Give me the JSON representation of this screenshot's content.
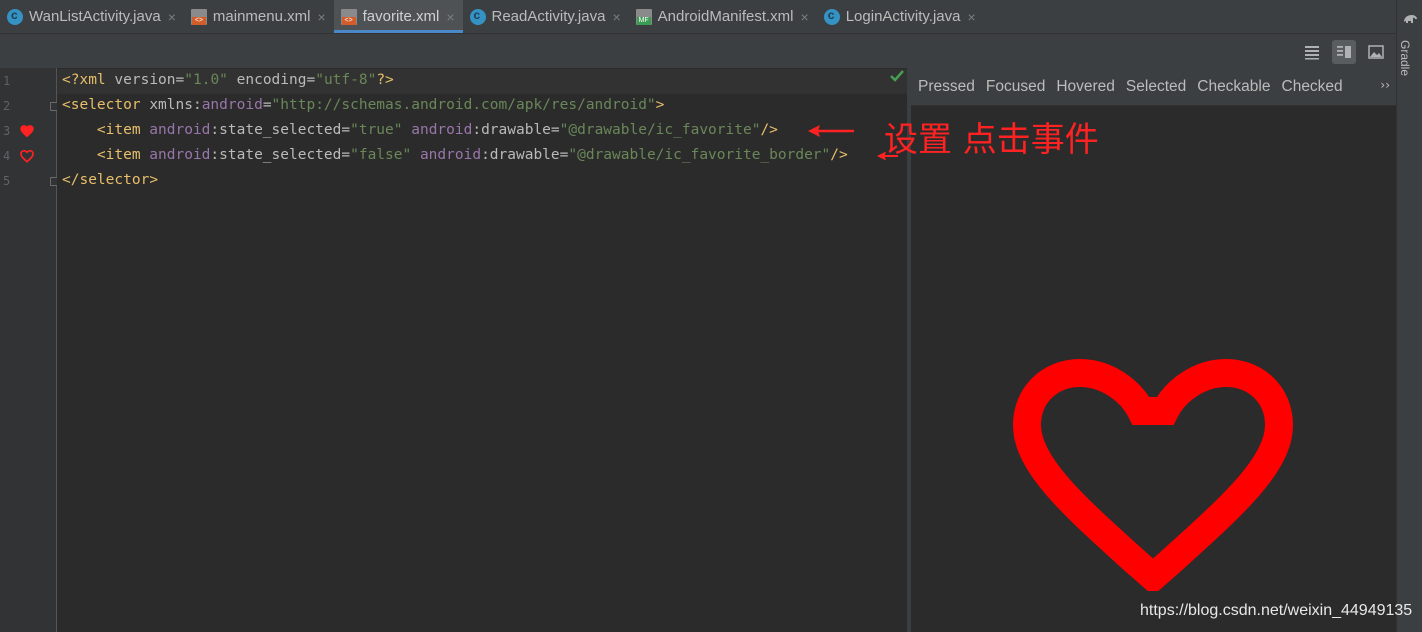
{
  "tabs": [
    {
      "label": "WanListActivity.java",
      "icon": "java-class-icon"
    },
    {
      "label": "mainmenu.xml",
      "icon": "xml-file-icon"
    },
    {
      "label": "favorite.xml",
      "icon": "xml-file-icon",
      "active": true
    },
    {
      "label": "ReadActivity.java",
      "icon": "java-class-icon"
    },
    {
      "label": "AndroidManifest.xml",
      "icon": "manifest-file-icon"
    },
    {
      "label": "LoginActivity.java",
      "icon": "java-class-icon"
    }
  ],
  "tab_close_glyph": "×",
  "toolbar": {
    "icons": [
      "code-view-icon",
      "split-view-icon",
      "design-view-icon"
    ],
    "active": "split-view-icon"
  },
  "gutter": {
    "line_numbers": [
      "1",
      "2",
      "3",
      "4",
      "5"
    ],
    "heart_color": "#ff2222"
  },
  "code": {
    "line1": {
      "open": "<?",
      "tag": "xml",
      "attr1": " version",
      "eq1": "=",
      "val1": "\"1.0\"",
      "attr2": " encoding",
      "eq2": "=",
      "val2": "\"utf-8\"",
      "close": "?>"
    },
    "line2": {
      "open": "<",
      "tag": "selector",
      "space": " ",
      "ns": "xmlns:",
      "nsname": "android",
      "eq": "=",
      "val": "\"http://schemas.android.com/apk/res/android\"",
      "close": ">"
    },
    "line3": {
      "indent": "    ",
      "open": "<",
      "tag": "item",
      "ns1": " android",
      "attr1": ":state_selected",
      "eq1": "=",
      "val1": "\"true\"",
      "ns2": " android",
      "attr2": ":drawable",
      "eq2": "=",
      "val2": "\"@drawable/ic_favorite\"",
      "close": "/>"
    },
    "line4": {
      "indent": "    ",
      "open": "<",
      "tag": "item",
      "ns1": " android",
      "attr1": ":state_selected",
      "eq1": "=",
      "val1": "\"false\"",
      "ns2": " android",
      "attr2": ":drawable",
      "eq2": "=",
      "val2": "\"@drawable/ic_favorite_border\"",
      "close": "/>"
    },
    "line5": {
      "open": "</",
      "tag": "selector",
      "close": ">"
    }
  },
  "preview": {
    "states": [
      "Pressed",
      "Focused",
      "Hovered",
      "Selected",
      "Checkable",
      "Checked"
    ],
    "more_glyph": "››",
    "heart_color": "#ff0000"
  },
  "annotation": {
    "text": "设置 点击事件",
    "color": "#ff2222"
  },
  "side_panel": {
    "label": "Gradle"
  },
  "watermark": "https://blog.csdn.net/weixin_44949135",
  "colors": {
    "accent": "#4a88c7",
    "check": "#499c54"
  }
}
